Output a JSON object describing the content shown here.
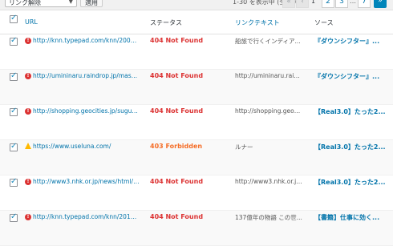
{
  "toolbar": {
    "bulk_action": "リンク解除",
    "apply_label": "適用",
    "count_text": "1-30 を表示中 (全 202)",
    "first_label": "«",
    "prev_label": "‹",
    "current_page": "1",
    "pages": [
      "2",
      "3"
    ],
    "dots": "…",
    "last_page": "7",
    "next_label": "»"
  },
  "table": {
    "headers": {
      "url": "URL",
      "status": "ステータス",
      "link_text": "リンクテキスト",
      "source": "ソース"
    },
    "rows": [
      {
        "url": "http://knn.typepad.com/knn/2004/0...",
        "status": "404 Not Found",
        "link_text": "船旅で行くインディア...",
        "source": "『ダウンシフター』..."
      },
      {
        "url": "http://umininaru.raindrop.jp/masaruk...",
        "status": "404 Not Found",
        "link_text": "http://umininaru.raind...",
        "source": "『ダウンシフター』..."
      },
      {
        "url": "http://shopping.geocities.jp/sugutuku/",
        "status": "404 Not Found",
        "link_text": "http://shopping.geocit...",
        "source": "【Real3.0】たった2..."
      },
      {
        "url": "https://www.useluna.com/",
        "status": "403 Forbidden",
        "link_text": "ルナー",
        "source": "【Real3.0】たった2..."
      },
      {
        "url": "http://www3.nhk.or.jp/news/html/20...",
        "status": "404 Not Found",
        "link_text": "http://www3.nhk.or.jp...",
        "source": "【Real3.0】たった2..."
      },
      {
        "url": "http://knn.typepad.com/knn/2014/0...",
        "status": "404 Not Found",
        "link_text": "137億年の物語 この世...",
        "source": "【書籍】仕事に効く..."
      }
    ]
  },
  "colors": {
    "error": "#dc3232",
    "warning": "#ffb900",
    "forbidden": "#f56e28",
    "link": "#0073aa"
  }
}
